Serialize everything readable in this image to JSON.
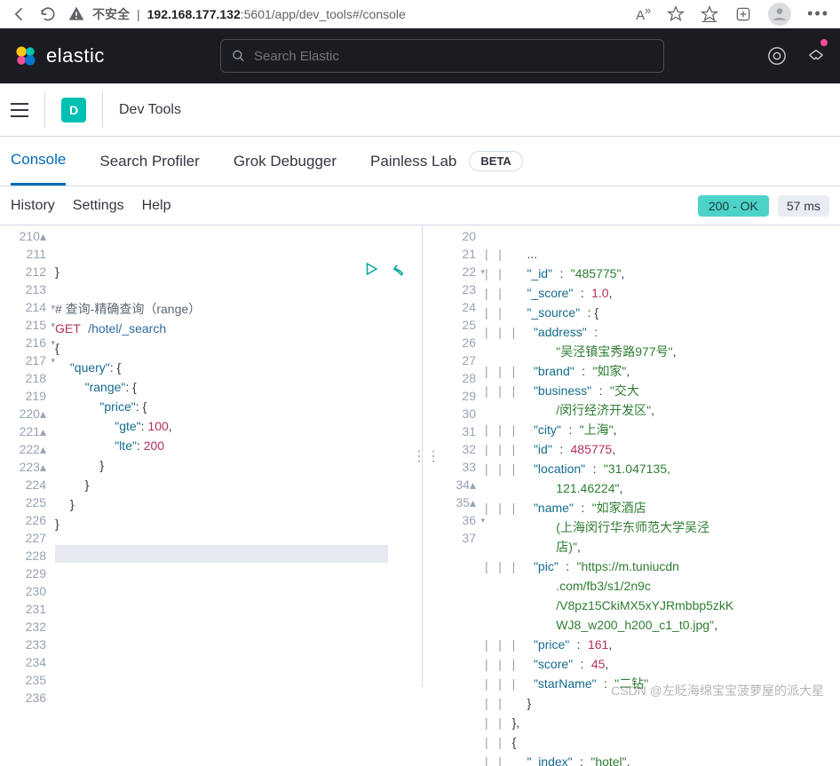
{
  "browser": {
    "insecure_label": "不安全",
    "url_host": "192.168.177.132",
    "url_rest": ":5601/app/dev_tools#/console"
  },
  "elastic_header": {
    "brand": "elastic",
    "search_placeholder": "Search Elastic"
  },
  "app": {
    "badge_letter": "D",
    "title": "Dev Tools"
  },
  "tabs": {
    "console": "Console",
    "profiler": "Search Profiler",
    "grok": "Grok Debugger",
    "painless": "Painless Lab",
    "beta": "BETA"
  },
  "toolbar": {
    "history": "History",
    "settings": "Settings",
    "help": "Help",
    "status_ok": "200 - OK",
    "status_time": "57 ms"
  },
  "request": {
    "line_start": 210,
    "comment": "# 查询-精确查询（range）",
    "method": "GET",
    "path": "/hotel/_search",
    "gte_key": "\"gte\"",
    "gte_val": "100",
    "lte_key": "\"lte\"",
    "lte_val": "200",
    "query_key": "\"query\"",
    "range_key": "\"range\"",
    "price_key": "\"price\""
  },
  "response": {
    "lines": {
      "l20": {
        "k": "\"_id\"",
        "v": "\"485775\""
      },
      "l21": {
        "k": "\"_score\"",
        "v": "1.0"
      },
      "l22": {
        "k": "\"_source\""
      },
      "l23": {
        "k": "\"address\""
      },
      "l23b": {
        "v": "\"吴泾镇宝秀路977号\""
      },
      "l24": {
        "k": "\"brand\"",
        "v": "\"如家\""
      },
      "l25": {
        "k": "\"business\"",
        "v": "\"交大/闵行经济开发区\""
      },
      "l26": {
        "k": "\"city\"",
        "v": "\"上海\""
      },
      "l27": {
        "k": "\"id\"",
        "v": "485775"
      },
      "l28": {
        "k": "\"location\"",
        "v": "\"31.047135, 121.46224\""
      },
      "l29": {
        "k": "\"name\"",
        "v": "\"如家酒店(上海闵行华东师范大学吴泾店)\""
      },
      "l30": {
        "k": "\"pic\"",
        "v": "\"https://m.tuniucdn.com/fb3/s1/2n9c/V8pz15CkiMX5xYJRmbbp5zkKWJ8_w200_h200_c1_t0.jpg\""
      },
      "l31": {
        "k": "\"price\"",
        "v": "161"
      },
      "l32": {
        "k": "\"score\"",
        "v": "45"
      },
      "l33": {
        "k": "\"starName\"",
        "v": "\"二钻\""
      },
      "l37": {
        "k": "\"_index\"",
        "v": "\"hotel\""
      }
    }
  },
  "watermark": "CSDN @左眨海绵宝宝菠萝屋的派大星"
}
